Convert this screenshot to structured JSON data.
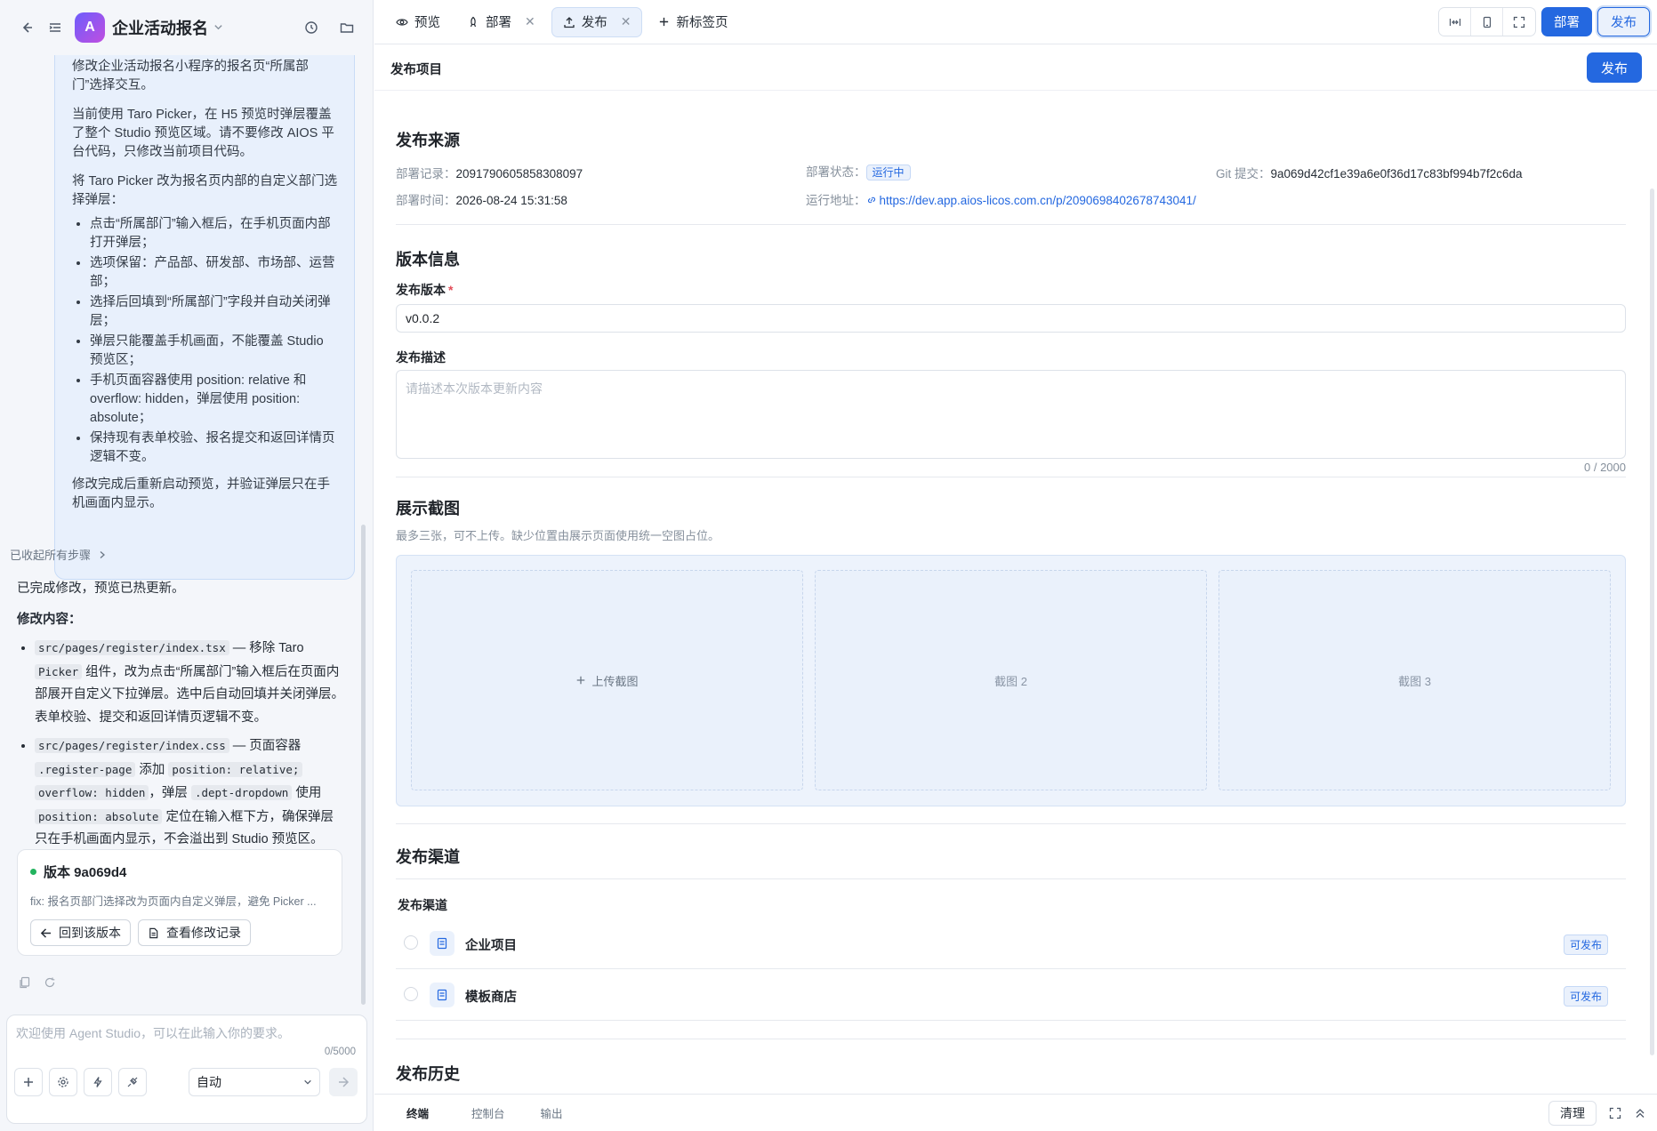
{
  "left": {
    "app_name": "企业活动报名",
    "app_initial": "A",
    "user_message": {
      "p1": "修改企业活动报名小程序的报名页“所属部门”选择交互。",
      "p2": "当前使用 Taro Picker，在 H5 预览时弹层覆盖了整个 Studio 预览区域。请不要修改 AIOS 平台代码，只修改当前项目代码。",
      "p3": "将 Taro Picker 改为报名页内部的自定义部门选择弹层：",
      "items": [
        "点击“所属部门”输入框后，在手机页面内部打开弹层；",
        "选项保留：产品部、研发部、市场部、运营部；",
        "选择后回填到“所属部门”字段并自动关闭弹层；",
        "弹层只能覆盖手机画面，不能覆盖 Studio 预览区；",
        "手机页面容器使用 position: relative 和 overflow: hidden，弹层使用 position: absolute；",
        "保持现有表单校验、报名提交和返回详情页逻辑不变。"
      ],
      "p4": "修改完成后重新启动预览，并验证弹层只在手机画面内显示。"
    },
    "collapsed_steps": "已收起所有步骤",
    "reply": {
      "intro": "已完成修改，预览已热更新。",
      "heading": "修改内容：",
      "item1": {
        "code1": "src/pages/register/index.tsx",
        "t1": " — 移除 Taro ",
        "code2": "Picker",
        "t2": " 组件，改为点击“所属部门”输入框后在页面内部展开自定义下拉弹层。选中后自动回填并关闭弹层。表单校验、提交和返回详情页逻辑不变。"
      },
      "item2": {
        "code1": "src/pages/register/index.css",
        "t1": " — 页面容器 ",
        "code2": ".register-page",
        "t2": " 添加 ",
        "code3": "position: relative;",
        "code4": "overflow: hidden",
        "t3": "，弹层 ",
        "code5": ".dept-dropdown",
        "t4": " 使用 ",
        "code6": "position: absolute",
        "t5": " 定位在输入框下方，确保弹层只在手机画面内显示，不会溢出到 Studio 预览区。"
      }
    },
    "version_card": {
      "title": "版本 9a069d4",
      "desc": "fix: 报名页部门选择改为页面内自定义弹层，避免 Picker ...",
      "revert": "回到该版本",
      "view_log": "查看修改记录"
    },
    "input": {
      "placeholder": "欢迎使用 Agent Studio，可以在此输入你的要求。",
      "count": "0/5000",
      "model": "自动"
    }
  },
  "tabs": [
    {
      "label": "预览",
      "closable": false
    },
    {
      "label": "部署",
      "closable": true
    },
    {
      "label": "发布",
      "closable": true,
      "active": true
    }
  ],
  "new_tab": "新标签页",
  "toolbar": {
    "deploy": "部署",
    "publish": "发布"
  },
  "sub_header": {
    "title": "发布项目",
    "publish": "发布"
  },
  "source": {
    "title": "发布来源",
    "record_k": "部署记录：",
    "record_v": "2091790605858308097",
    "status_k": "部署状态：",
    "status_v": "运行中",
    "git_k": "Git 提交：",
    "git_v": "9a069d42cf1e39a6e0f36d17c83bf994b7f2c6da",
    "time_k": "部署时间：",
    "time_v": "2026-08-24 15:31:58",
    "url_k": "运行地址：",
    "url_v": "https://dev.app.aios-licos.com.cn/p/2090698402678743041/"
  },
  "version": {
    "title": "版本信息",
    "ver_label": "发布版本",
    "ver_value": "v0.0.2",
    "desc_label": "发布描述",
    "desc_placeholder": "请描述本次版本更新内容",
    "desc_count": "0 / 2000"
  },
  "screens": {
    "title": "展示截图",
    "hint": "最多三张，可不上传。缺少位置由展示页面使用统一空图占位。",
    "upload": "上传截图",
    "slot2": "截图 2",
    "slot3": "截图 3"
  },
  "channels": {
    "title": "发布渠道",
    "sub": "发布渠道",
    "items": [
      {
        "name": "企业项目",
        "badge": "可发布"
      },
      {
        "name": "模板商店",
        "badge": "可发布"
      }
    ]
  },
  "history": {
    "title": "发布历史"
  },
  "bottom": {
    "tabs": [
      "终端",
      "控制台",
      "输出"
    ],
    "clear": "清理"
  }
}
